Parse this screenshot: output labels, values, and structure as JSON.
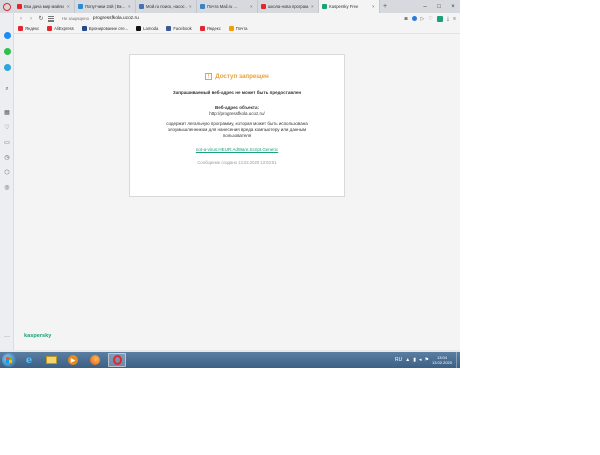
{
  "tabs": [
    {
      "title": "Вsa дача мир майли с ...",
      "fav_color": "#e4262c",
      "active": false
    },
    {
      "title": "Попутчики 24й | Вк...",
      "fav_color": "#2a8bd6",
      "active": false
    },
    {
      "title": "Мой.ru поиск, насос ...",
      "fav_color": "#4a6fb5",
      "active": false
    },
    {
      "title": "Почта Mail.ru ...",
      "fav_color": "#3b82c4",
      "active": false
    },
    {
      "title": "школа-нова програм...",
      "fav_color": "#e4262c",
      "active": false
    },
    {
      "title": "Kaspersky Free",
      "fav_color": "#1aa179",
      "active": true
    }
  ],
  "address": {
    "insecure_note": "Не защищено",
    "url": "progressfkola.ucoz.ru"
  },
  "bookmarks": [
    {
      "label": "Яндекс",
      "color": "#e4262c"
    },
    {
      "label": "AliExpress",
      "color": "#e4262c"
    },
    {
      "label": "Бронирование оте...",
      "color": "#1f4a8e"
    },
    {
      "label": "Lamoda",
      "color": "#111111"
    },
    {
      "label": "Facebook",
      "color": "#3b5998"
    },
    {
      "label": "Яндекс",
      "color": "#e4262c"
    },
    {
      "label": "Почта",
      "color": "#f2a000"
    }
  ],
  "card": {
    "title": "Доступ запрещен",
    "subtitle": "Запрашиваемый веб-адрес не может быть предоставлен",
    "object_label": "Веб-адрес объекта:",
    "object_url": "http://progressfkola.ucoz.ru/",
    "desc_line1": "содержит легальную программу, которая может быть использована",
    "desc_line2": "злоумышленником для нанесения вреда компьютеру или данным",
    "desc_line3": "пользователя",
    "threat_name": "not-a-virus:HEUR:AdWare.Script.Generic",
    "timestamp": "Сообщение создано 13.02.2020 13:03:51",
    "logo": "kaspersky"
  },
  "taskbar": {
    "language": "RU",
    "time": "13:04",
    "date": "13.02.2020"
  }
}
